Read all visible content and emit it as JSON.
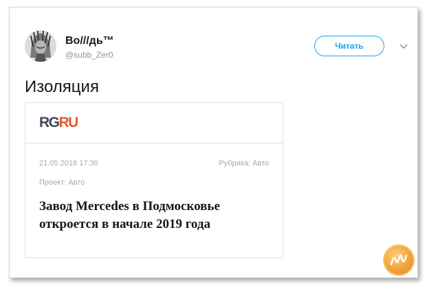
{
  "tweet": {
    "author_name": "Во///дь™",
    "handle": "@subb_Zer0",
    "follow_label": "Читать",
    "text": "Изоляция"
  },
  "article": {
    "logo_part1": "RG",
    "logo_part2": "RU",
    "date": "21.05.2018 17:30",
    "rubric": "Рубрика: Авто",
    "project": "Проект: Авто",
    "headline": "Завод Mercedes в Подмосковье откроется в начале 2019 года"
  },
  "icons": {
    "avatar": "indian-chief-avatar",
    "menu": "chevron-down-icon",
    "watermark": "nyka-logo"
  },
  "colors": {
    "accent": "#1da1f2",
    "logo_dark": "#3f4a56",
    "logo_orange": "#e5592a",
    "meta_gray": "#a3a8ad"
  }
}
